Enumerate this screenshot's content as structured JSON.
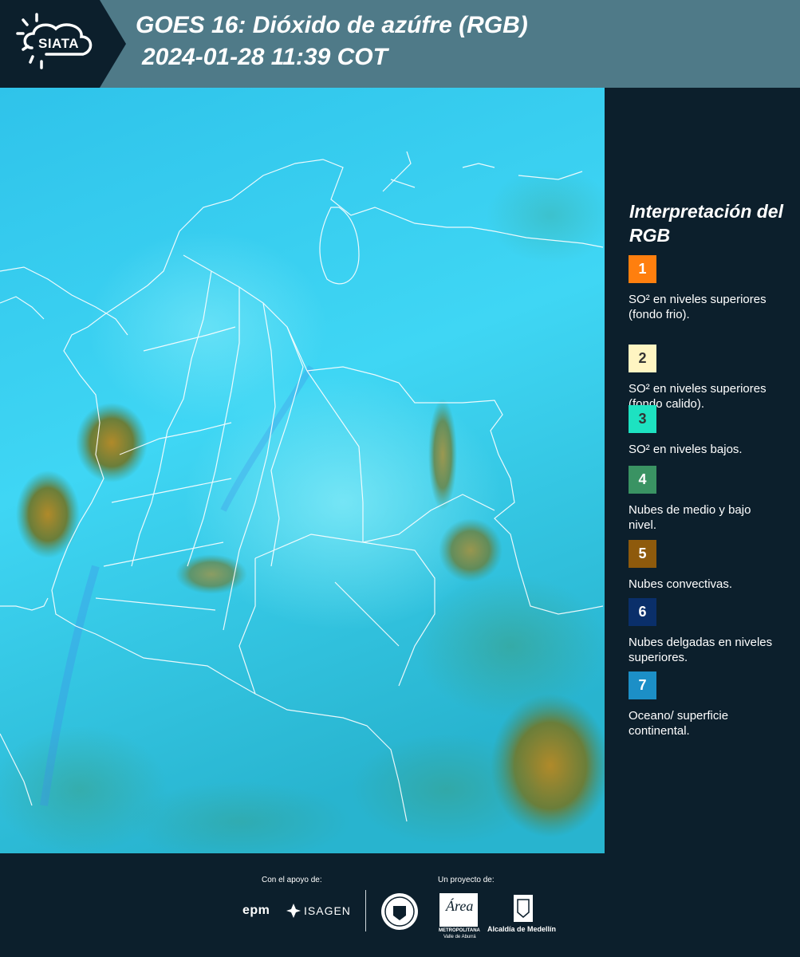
{
  "header": {
    "logo_text": "SIATA",
    "title": "GOES 16: Dióxido de azúfre (RGB)",
    "subtitle": "2024-01-28 11:39 COT"
  },
  "legend": {
    "title": "Interpretación del RGB",
    "items": [
      {
        "number": "1",
        "label": "SO² en niveles superiores (fondo frio).",
        "color": "#ff7f0e",
        "number_color": "#ffffff"
      },
      {
        "number": "2",
        "label": "SO² en niveles superiores (fondo calido).",
        "color": "#fff5c2",
        "number_color": "#333333"
      },
      {
        "number": "3",
        "label": "SO² en niveles bajos.",
        "color": "#1de2c1",
        "number_color": "#333333"
      },
      {
        "number": "4",
        "label": "Nubes de medio y bajo nivel.",
        "color": "#3a9363",
        "number_color": "#ffffff"
      },
      {
        "number": "5",
        "label": "Nubes convectivas.",
        "color": "#8e5a0c",
        "number_color": "#ffffff"
      },
      {
        "number": "6",
        "label": "Nubes delgadas en niveles superiores.",
        "color": "#0a2f6a",
        "number_color": "#ffffff"
      },
      {
        "number": "7",
        "label": "Oceano/ superficie continental.",
        "color": "#1c8fc7",
        "number_color": "#ffffff"
      }
    ]
  },
  "footer": {
    "support_label": "Con el apoyo de:",
    "project_label": "Un proyecto de:",
    "sponsor_1": "epm",
    "sponsor_2": "ISAGEN",
    "partner_area": "Área",
    "partner_area_sub": "METROPOLITANA",
    "partner_area_sub2": "Valle de Aburrá",
    "partner_alcaldia": "Alcaldía de Medellín"
  },
  "colors": {
    "header_bg": "#4f7a88",
    "panel_bg": "#0c1f2c",
    "map_base": "#2ec4e8"
  }
}
